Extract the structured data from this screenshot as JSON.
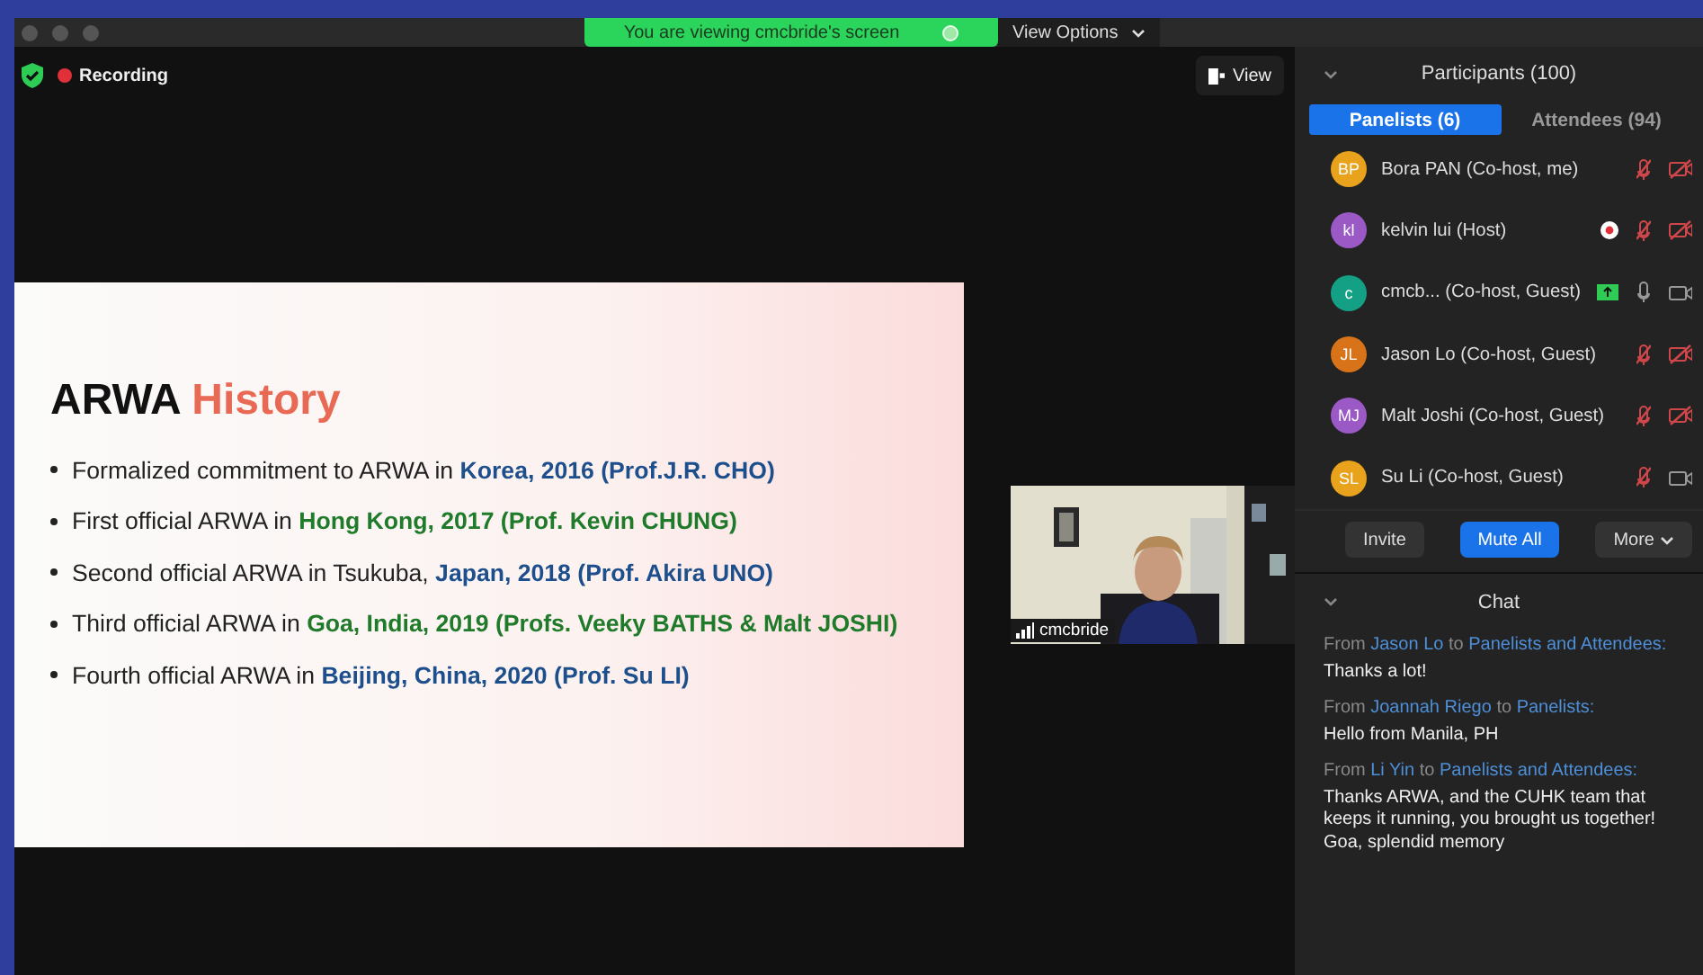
{
  "banner": {
    "text": "You are viewing cmcbride's screen",
    "options": "View Options"
  },
  "meeting": {
    "recording": "Recording",
    "view_button": "View"
  },
  "slide": {
    "title": [
      {
        "text": "ARWA",
        "accent": false
      },
      {
        "text": "History",
        "accent": true
      }
    ],
    "bullets": [
      {
        "parts": [
          {
            "text": "Formalized commitment to ARWA in ",
            "kind": "plain"
          },
          {
            "text": "Korea, 2016 (Prof.J.R. CHO)",
            "kind": "blue"
          }
        ]
      },
      {
        "parts": [
          {
            "text": "First official ARWA in ",
            "kind": "plain"
          },
          {
            "text": "Hong Kong, 2017 (Prof. Kevin CHUNG)",
            "kind": "green"
          }
        ]
      },
      {
        "parts": [
          {
            "text": "Second official ARWA in Tsukuba, ",
            "kind": "plain"
          },
          {
            "text": "Japan, 2018 (Prof. Akira UNO)",
            "kind": "blue"
          }
        ]
      },
      {
        "parts": [
          {
            "text": "Third official ARWA in ",
            "kind": "plain"
          },
          {
            "text": "Goa, India, 2019 (Profs. Veeky BATHS & Malt JOSHI)",
            "kind": "green"
          }
        ]
      },
      {
        "parts": [
          {
            "text": "Fourth official ARWA in ",
            "kind": "plain"
          },
          {
            "text": "Beijing, China, 2020 (Prof. Su LI)",
            "kind": "blue"
          }
        ]
      }
    ]
  },
  "video": {
    "kind": "picture",
    "name": "cmcbride"
  },
  "participants": {
    "title": "Participants (100)",
    "tabs": [
      {
        "label": "Panelists (6)",
        "selected": true
      },
      {
        "label": "Attendees (94)",
        "selected": false
      }
    ],
    "rows": [
      {
        "initials": "BP",
        "name": "Bora PAN (Co-host, me)",
        "color": "#e8a21c",
        "recording": false,
        "sharing": false,
        "audio_muted": true,
        "video_off": true
      },
      {
        "initials": "kl",
        "name": "kelvin lui (Host)",
        "color": "#9b59c6",
        "recording": true,
        "sharing": false,
        "audio_muted": true,
        "video_off": true
      },
      {
        "initials": "c",
        "name": "cmcb... (Co-host, Guest)",
        "color": "#14a085",
        "recording": false,
        "sharing": true,
        "audio_muted": false,
        "video_off": false
      },
      {
        "initials": "JL",
        "name": "Jason Lo (Co-host, Guest)",
        "color": "#d9731a",
        "recording": false,
        "sharing": false,
        "audio_muted": true,
        "video_off": true
      },
      {
        "initials": "MJ",
        "name": "Malt Joshi (Co-host, Guest)",
        "color": "#9b59c6",
        "recording": false,
        "sharing": false,
        "audio_muted": true,
        "video_off": true
      },
      {
        "initials": "SL",
        "name": "Su Li (Co-host, Guest)",
        "color": "#e8a21c",
        "recording": false,
        "sharing": false,
        "audio_muted": true,
        "video_off": false
      }
    ],
    "buttons": [
      {
        "label": "Invite",
        "primary": false
      },
      {
        "label": "Mute All",
        "primary": true
      },
      {
        "label": "More",
        "primary": false
      }
    ]
  },
  "chat": {
    "title": "Chat",
    "messages": [
      {
        "from_label": "From",
        "from": "Jason Lo",
        "to_label": "to",
        "to": "Panelists and Attendees:",
        "text": "Thanks a lot!"
      },
      {
        "from_label": "From",
        "from": "Joannah Riego",
        "to_label": "to",
        "to": "Panelists:",
        "text": "Hello from Manila, PH"
      },
      {
        "from_label": "From",
        "from": "Li Yin",
        "to_label": "to",
        "to": "Panelists and Attendees:",
        "text": "Thanks ARWA, and the CUHK team that keeps it running, you brought us together! Goa, splendid memory"
      }
    ]
  }
}
